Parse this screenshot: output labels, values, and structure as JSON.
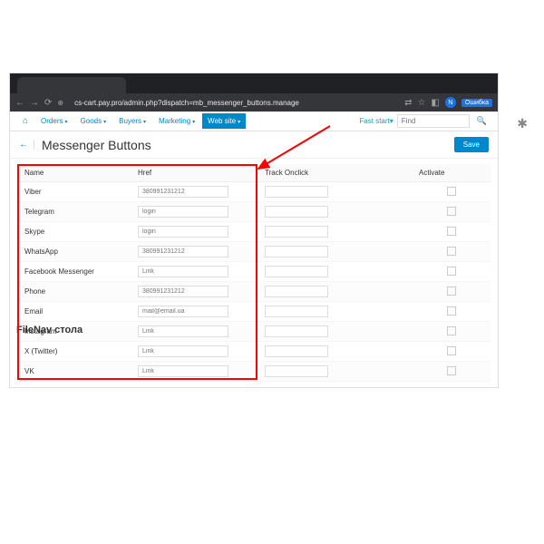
{
  "browser": {
    "url": "cs-cart.pay.pro/admin.php?dispatch=mb_messenger_buttons.manage",
    "avatar_letter": "N",
    "error_btn": "Ошибка"
  },
  "menu": {
    "items": [
      "Orders",
      "Goods",
      "Buyers",
      "Marketing",
      "Web site"
    ],
    "active_index": 4,
    "fast_start": "Fast start",
    "find_placeholder": "Find"
  },
  "page": {
    "title": "Messenger Buttons",
    "save": "Save"
  },
  "table": {
    "headers": {
      "name": "Name",
      "href": "Href",
      "track": "Track Onclick",
      "activate": "Activate"
    },
    "rows": [
      {
        "name": "Viber",
        "href": "380991231212"
      },
      {
        "name": "Telegram",
        "href": "login"
      },
      {
        "name": "Skype",
        "href": "login"
      },
      {
        "name": "WhatsApp",
        "href": "380991231212"
      },
      {
        "name": "Facebook Messenger",
        "href": "Link"
      },
      {
        "name": "Phone",
        "href": "380991231212"
      },
      {
        "name": "Email",
        "href": "mail@email.ua"
      },
      {
        "name": "Instagram",
        "href": "Link"
      },
      {
        "name": "X (Twitter)",
        "href": "Link"
      },
      {
        "name": "VK",
        "href": "Link"
      }
    ]
  },
  "filenav": "FileNav стола"
}
